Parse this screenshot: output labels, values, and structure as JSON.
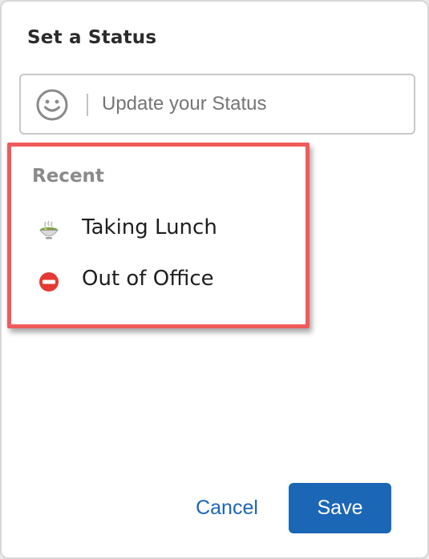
{
  "dialog": {
    "title": "Set a Status"
  },
  "status_input": {
    "icon": "smiley-face-icon",
    "placeholder": "Update your Status",
    "value": ""
  },
  "recent": {
    "heading": "Recent",
    "items": [
      {
        "icon": "soup-bowl-emoji-icon",
        "label": "Taking Lunch"
      },
      {
        "icon": "no-entry-emoji-icon",
        "label": "Out of Office"
      }
    ]
  },
  "actions": {
    "cancel_label": "Cancel",
    "save_label": "Save"
  },
  "colors": {
    "accent": "#1c66b6",
    "highlight_border": "#f05a5a",
    "no_entry_red": "#e53935"
  }
}
